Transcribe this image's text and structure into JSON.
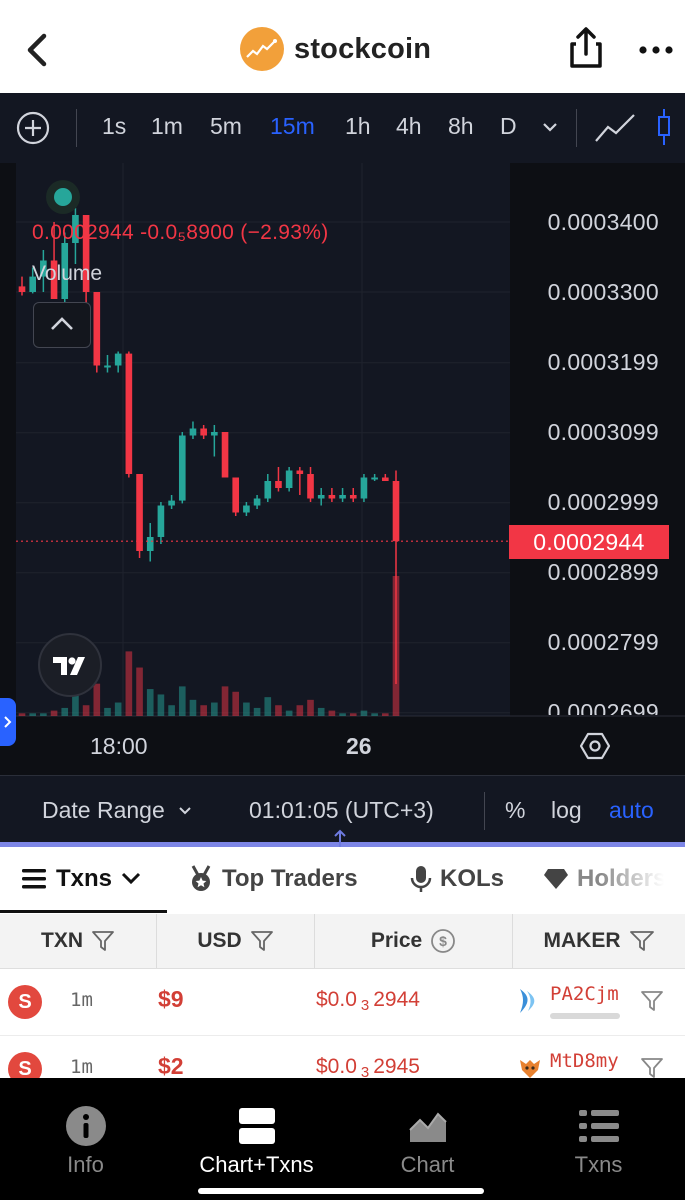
{
  "app": {
    "name": "stockcoin"
  },
  "toolbar": {
    "timeframes": [
      "1s",
      "1m",
      "5m",
      "15m",
      "1h",
      "4h",
      "8h",
      "D"
    ],
    "active_timeframe": "15m"
  },
  "legend": {
    "ohlc_text": "0.0002944  -0.0₅8900 (−2.93%)",
    "volume_label": "Volume"
  },
  "price_axis": {
    "labels": [
      "0.0003400",
      "0.0003300",
      "0.0003199",
      "0.0003099",
      "0.0002999",
      "0.0002899",
      "0.0002799",
      "0.0002699"
    ],
    "current_price": "0.0002944"
  },
  "time_axis": {
    "labels": [
      "18:00",
      "26"
    ]
  },
  "range_bar": {
    "date_range": "Date Range",
    "clock": "01:01:05 (UTC+3)",
    "percent": "%",
    "log": "log",
    "auto": "auto"
  },
  "tabs": [
    {
      "label": "Txns",
      "icon": "menu-icon"
    },
    {
      "label": "Top Traders",
      "icon": "medal-icon"
    },
    {
      "label": "KOLs",
      "icon": "microphone-icon"
    },
    {
      "label": "Holders",
      "icon": "diamond-icon"
    }
  ],
  "table": {
    "headers": [
      "TXN",
      "USD",
      "Price",
      "MAKER"
    ],
    "rows": [
      {
        "side": "S",
        "age": "1m",
        "usd": "$9",
        "price_prefix": "$0.0",
        "price_zeros": "3",
        "price_digits": "2944",
        "maker": "PA2Cjm",
        "maker_icon": "wing-icon"
      },
      {
        "side": "S",
        "age": "1m",
        "usd": "$2",
        "price_prefix": "$0.0",
        "price_zeros": "3",
        "price_digits": "2945",
        "maker": "MtD8my",
        "maker_icon": "fox-icon"
      }
    ]
  },
  "bottom_nav": [
    {
      "label": "Info",
      "icon": "info-icon"
    },
    {
      "label": "Chart+Txns",
      "icon": "split-view-icon"
    },
    {
      "label": "Chart",
      "icon": "area-chart-icon"
    },
    {
      "label": "Txns",
      "icon": "list-icon"
    }
  ],
  "colors": {
    "up": "#26a69a",
    "down": "#f23645",
    "accent": "#2962ff"
  },
  "chart_data": {
    "type": "candlestick",
    "interval": "15m",
    "y_axis_ticks": [
      0.00034,
      0.00033,
      0.0003199,
      0.0003099,
      0.0002999,
      0.0002899,
      0.0002799,
      0.0002699
    ],
    "x_axis_ticks": [
      "18:00",
      "26"
    ],
    "last_price": 0.0002944,
    "change": "-0.0₅8900",
    "change_pct": -2.93,
    "candles": [
      {
        "o": 0.0003308,
        "h": 0.0003322,
        "l": 0.0003295,
        "c": 0.00033,
        "v": 1
      },
      {
        "o": 0.00033,
        "h": 0.0003335,
        "l": 0.0003298,
        "c": 0.0003322,
        "v": 1
      },
      {
        "o": 0.0003322,
        "h": 0.000336,
        "l": 0.00033,
        "c": 0.0003345,
        "v": 1
      },
      {
        "o": 0.0003345,
        "h": 0.00034,
        "l": 0.000329,
        "c": 0.000329,
        "v": 2
      },
      {
        "o": 0.000329,
        "h": 0.0003385,
        "l": 0.0003285,
        "c": 0.000337,
        "v": 3
      },
      {
        "o": 0.000337,
        "h": 0.000342,
        "l": 0.000334,
        "c": 0.000341,
        "v": 8
      },
      {
        "o": 0.000341,
        "h": 0.000341,
        "l": 0.000328,
        "c": 0.00033,
        "v": 4
      },
      {
        "o": 0.00033,
        "h": 0.00033,
        "l": 0.0003185,
        "c": 0.0003195,
        "v": 12
      },
      {
        "o": 0.0003195,
        "h": 0.000321,
        "l": 0.0003185,
        "c": 0.0003195,
        "v": 3
      },
      {
        "o": 0.0003195,
        "h": 0.0003215,
        "l": 0.0003185,
        "c": 0.0003212,
        "v": 5
      },
      {
        "o": 0.0003212,
        "h": 0.0003215,
        "l": 0.0003035,
        "c": 0.000304,
        "v": 24
      },
      {
        "o": 0.000304,
        "h": 0.000304,
        "l": 0.000292,
        "c": 0.000293,
        "v": 18
      },
      {
        "o": 0.000293,
        "h": 0.000297,
        "l": 0.0002915,
        "c": 0.000295,
        "v": 10
      },
      {
        "o": 0.000295,
        "h": 0.0003,
        "l": 0.000294,
        "c": 0.0002995,
        "v": 8
      },
      {
        "o": 0.0002995,
        "h": 0.000301,
        "l": 0.000299,
        "c": 0.0003002,
        "v": 4
      },
      {
        "o": 0.0003002,
        "h": 0.00031,
        "l": 0.0002998,
        "c": 0.0003095,
        "v": 11
      },
      {
        "o": 0.0003095,
        "h": 0.0003115,
        "l": 0.000309,
        "c": 0.0003105,
        "v": 6
      },
      {
        "o": 0.0003105,
        "h": 0.000311,
        "l": 0.000309,
        "c": 0.0003095,
        "v": 4
      },
      {
        "o": 0.0003095,
        "h": 0.000311,
        "l": 0.0003065,
        "c": 0.00031,
        "v": 5
      },
      {
        "o": 0.00031,
        "h": 0.00031,
        "l": 0.0003035,
        "c": 0.0003035,
        "v": 11
      },
      {
        "o": 0.0003035,
        "h": 0.0003035,
        "l": 0.000298,
        "c": 0.0002985,
        "v": 9
      },
      {
        "o": 0.0002985,
        "h": 0.0003,
        "l": 0.000298,
        "c": 0.0002995,
        "v": 5
      },
      {
        "o": 0.0002995,
        "h": 0.000301,
        "l": 0.000299,
        "c": 0.0003005,
        "v": 3
      },
      {
        "o": 0.0003005,
        "h": 0.000304,
        "l": 0.0003,
        "c": 0.000303,
        "v": 7
      },
      {
        "o": 0.000303,
        "h": 0.000305,
        "l": 0.0003015,
        "c": 0.000302,
        "v": 4
      },
      {
        "o": 0.000302,
        "h": 0.000305,
        "l": 0.0003015,
        "c": 0.0003045,
        "v": 2
      },
      {
        "o": 0.0003045,
        "h": 0.000305,
        "l": 0.000301,
        "c": 0.000304,
        "v": 4
      },
      {
        "o": 0.000304,
        "h": 0.000305,
        "l": 0.0003,
        "c": 0.0003005,
        "v": 6
      },
      {
        "o": 0.0003005,
        "h": 0.000302,
        "l": 0.0002995,
        "c": 0.000301,
        "v": 3
      },
      {
        "o": 0.000301,
        "h": 0.000302,
        "l": 0.0003,
        "c": 0.0003005,
        "v": 2
      },
      {
        "o": 0.0003005,
        "h": 0.000302,
        "l": 0.0003,
        "c": 0.000301,
        "v": 1
      },
      {
        "o": 0.000301,
        "h": 0.000302,
        "l": 0.0003,
        "c": 0.0003005,
        "v": 1
      },
      {
        "o": 0.0003005,
        "h": 0.000304,
        "l": 0.0003,
        "c": 0.0003035,
        "v": 2
      },
      {
        "o": 0.0003035,
        "h": 0.000304,
        "l": 0.000303,
        "c": 0.0003035,
        "v": 1
      },
      {
        "o": 0.0003035,
        "h": 0.000304,
        "l": 0.000303,
        "c": 0.000303,
        "v": 1
      },
      {
        "o": 0.000303,
        "h": 0.0003045,
        "l": 0.000274,
        "c": 0.0002944,
        "v": 52
      }
    ]
  }
}
